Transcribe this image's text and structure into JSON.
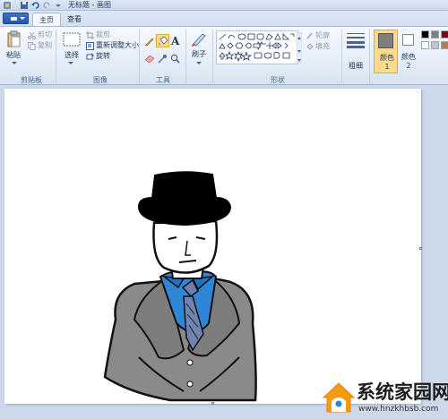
{
  "window": {
    "title": "无标题 - 画图"
  },
  "tabs": [
    {
      "label": "主页",
      "active": true
    },
    {
      "label": "查看",
      "active": false
    }
  ],
  "clipboard": {
    "paste_label": "粘贴",
    "cut_label": "剪切",
    "copy_label": "复制",
    "group_label": "剪贴板"
  },
  "image": {
    "select_label": "选择",
    "crop_label": "裁剪",
    "resize_label": "重新调整大小",
    "rotate_label": "旋转",
    "group_label": "图像"
  },
  "tools": {
    "group_label": "工具"
  },
  "brushes": {
    "label": "刷子"
  },
  "shapes": {
    "outline_label": "轮廓",
    "fill_label": "填充",
    "group_label": "形状"
  },
  "size": {
    "label": "粗细"
  },
  "colors": {
    "color1_label": "颜色 1",
    "color2_label": "颜色 2",
    "color1_value": "#7f7f7f",
    "color2_value": "#ffffff",
    "palette": [
      "#000000",
      "#7f7f7f",
      "#880015",
      "#ffffff",
      "#c3c3c3",
      "#b97a57"
    ]
  },
  "watermark": {
    "text": "系统家园网",
    "url": "www.hnzkhbsb.com"
  },
  "icons": [
    "save-icon",
    "undo-icon",
    "redo-icon",
    "paste-icon",
    "cut-icon",
    "copy-icon",
    "select-icon",
    "crop-icon",
    "resize-icon",
    "rotate-icon",
    "pencil-icon",
    "fill-icon",
    "text-icon",
    "eraser-icon",
    "color-picker-icon",
    "magnifier-icon",
    "brush-icon",
    "size-icon",
    "house-logo-icon"
  ]
}
